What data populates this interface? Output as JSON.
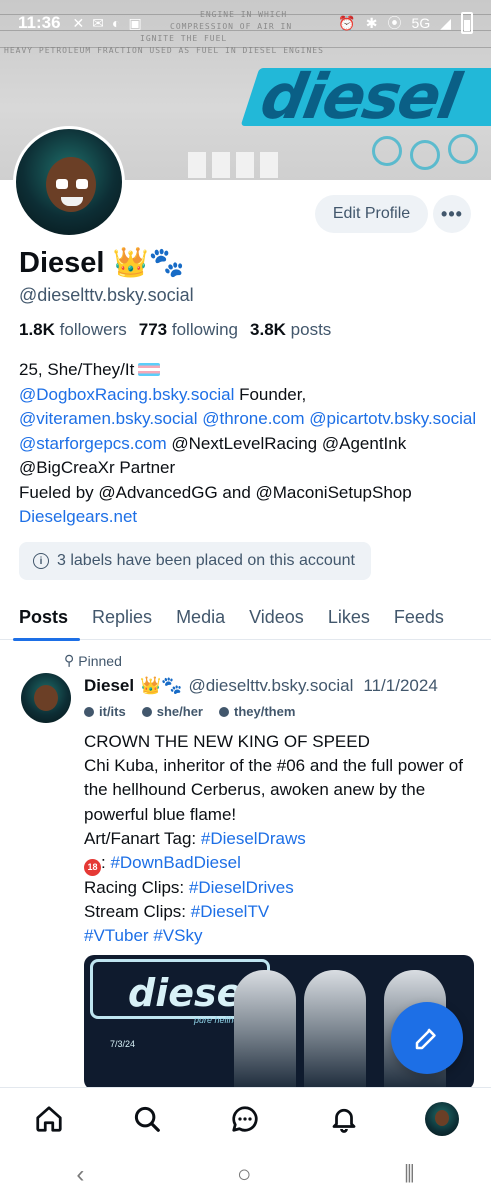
{
  "status_bar": {
    "time": "11:36",
    "network": "5G"
  },
  "banner": {
    "logo_text": "diesel",
    "caption_lines": [
      "ENGINE IN WHICH",
      "COMPRESSION OF AIR IN",
      "IGNITE THE FUEL",
      "HEAVY PETROLEUM FRACTION USED AS FUEL IN DIESEL ENGINES"
    ]
  },
  "profile": {
    "display_name": "Diesel",
    "name_emoji": "👑🐾",
    "handle": "@dieselttv.bsky.social",
    "edit_label": "Edit Profile",
    "more_label": "•••",
    "followers_count": "1.8K",
    "followers_label": "followers",
    "following_count": "773",
    "following_label": "following",
    "posts_count": "3.8K",
    "posts_label": "posts",
    "bio": {
      "line1": "25, She/They/It",
      "link_dogbox": "@DogboxRacing.bsky.social",
      "founder": " Founder, ",
      "link_viteramen": "@viteramen.bsky.social",
      "link_throne": "@throne.com",
      "link_picarto": "@picartotv.bsky.social",
      "link_starforge": "@starforgepcs.com",
      "partners": " @NextLevelRacing @AgentInk @BigCreaXr Partner",
      "fueled": "Fueled by @AdvancedGG and @MaconiSetupShop",
      "website": "Dieselgears.net"
    },
    "labels_notice": "3 labels have been placed on this account"
  },
  "tabs": [
    "Posts",
    "Replies",
    "Media",
    "Videos",
    "Likes",
    "Feeds"
  ],
  "post": {
    "pinned_label": "Pinned",
    "author": "Diesel",
    "author_emoji": "👑🐾",
    "handle": "@dieselttv.bsky.social",
    "date": "11/1/2024",
    "pronoun_labels": [
      "it/its",
      "she/her",
      "they/them"
    ],
    "line1": "CROWN THE NEW KING OF SPEED",
    "line2": "Chi Kuba, inheritor of the #06 and the full power of the hellhound Cerberus, awoken anew by the powerful blue flame!",
    "art_prefix": "Art/Fanart Tag: ",
    "art_tag": "#DieselDraws",
    "badge": "18",
    "nsfw_prefix": ": ",
    "nsfw_tag": "#DownBadDiesel",
    "racing_prefix": "Racing Clips: ",
    "racing_tag": "#DieselDrives",
    "stream_prefix": "Stream Clips: ",
    "stream_tag": "#DieselTV",
    "tag_vtuber": "#VTuber",
    "tag_vsky": "#VSky",
    "image": {
      "logo_text": "diesel",
      "subtitle": "pure hellhound",
      "date": "7/3/24"
    }
  },
  "colors": {
    "accent": "#1d6fe6",
    "text_muted": "#42576c",
    "chip_bg": "#eef2f6"
  }
}
